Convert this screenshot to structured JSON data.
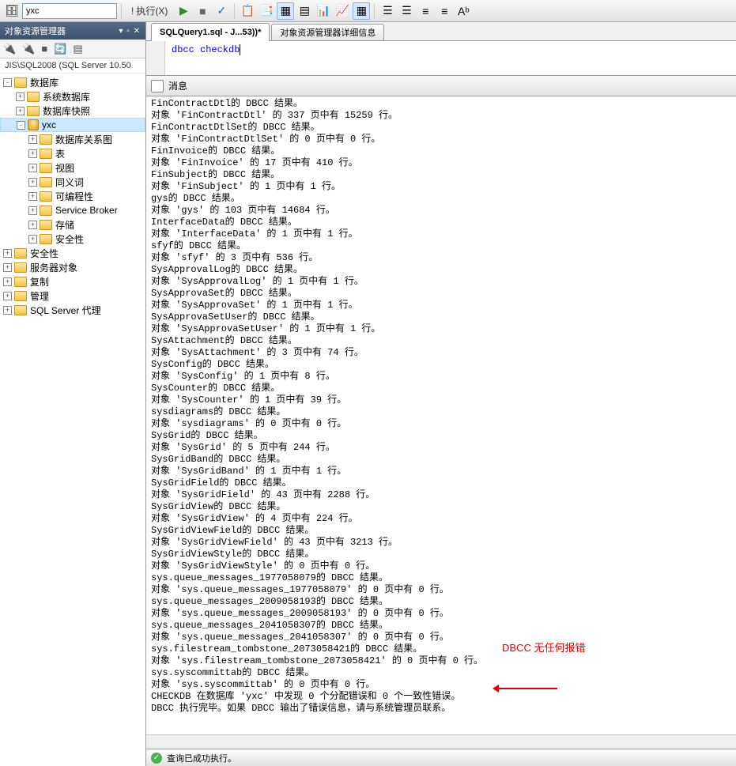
{
  "toolbar": {
    "combo_value": "yxc",
    "exec_label": "执行(X)",
    "icons": [
      "play-icon",
      "debug-icon",
      "check-icon",
      "new-icon",
      "save-icon",
      "grid-icon",
      "grid2-icon",
      "table-icon",
      "cols-icon",
      "props-icon",
      "sep",
      "indent-icon",
      "outdent-icon",
      "left-icon",
      "right-icon",
      "font-icon"
    ]
  },
  "sidebar": {
    "title": "对象资源管理器",
    "pin_label": "▾ ▫ ✕",
    "server": "JIS\\SQL2008 (SQL Server 10.50",
    "tools": [
      "🔗",
      "🔗",
      "▦",
      "🔄",
      "▤"
    ],
    "items": [
      {
        "level": 0,
        "exp": "-",
        "type": "folder",
        "label": "数据库",
        "sel": false
      },
      {
        "level": 1,
        "exp": "+",
        "type": "folder",
        "label": "系统数据库",
        "sel": false
      },
      {
        "level": 1,
        "exp": "+",
        "type": "folder",
        "label": "数据库快照",
        "sel": false
      },
      {
        "level": 1,
        "exp": "-",
        "type": "db",
        "label": "yxc",
        "sel": true
      },
      {
        "level": 2,
        "exp": "+",
        "type": "folder",
        "label": "数据库关系图",
        "sel": false
      },
      {
        "level": 2,
        "exp": "+",
        "type": "folder",
        "label": "表",
        "sel": false
      },
      {
        "level": 2,
        "exp": "+",
        "type": "folder",
        "label": "视图",
        "sel": false
      },
      {
        "level": 2,
        "exp": "+",
        "type": "folder",
        "label": "同义词",
        "sel": false
      },
      {
        "level": 2,
        "exp": "+",
        "type": "folder",
        "label": "可编程性",
        "sel": false
      },
      {
        "level": 2,
        "exp": "+",
        "type": "folder",
        "label": "Service Broker",
        "sel": false
      },
      {
        "level": 2,
        "exp": "+",
        "type": "folder",
        "label": "存储",
        "sel": false
      },
      {
        "level": 2,
        "exp": "+",
        "type": "folder",
        "label": "安全性",
        "sel": false
      },
      {
        "level": 0,
        "exp": "+",
        "type": "folder",
        "label": "安全性",
        "sel": false
      },
      {
        "level": 0,
        "exp": "+",
        "type": "folder",
        "label": "服务器对象",
        "sel": false
      },
      {
        "level": 0,
        "exp": "+",
        "type": "folder",
        "label": "复制",
        "sel": false
      },
      {
        "level": 0,
        "exp": "+",
        "type": "folder",
        "label": "管理",
        "sel": false
      },
      {
        "level": 0,
        "exp": "+",
        "type": "folder",
        "label": "SQL Server 代理",
        "sel": false
      }
    ]
  },
  "tabs": {
    "active": "SQLQuery1.sql - J...53))*",
    "other": "对象资源管理器详细信息"
  },
  "editor": {
    "code_keyword": "dbcc checkdb"
  },
  "messages_tab": "消息",
  "results": [
    "FinContractDtl的 DBCC 结果。",
    "对象 'FinContractDtl' 的 337 页中有 15259 行。",
    "FinContractDtlSet的 DBCC 结果。",
    "对象 'FinContractDtlSet' 的 0 页中有 0 行。",
    "FinInvoice的 DBCC 结果。",
    "对象 'FinInvoice' 的 17 页中有 410 行。",
    "FinSubject的 DBCC 结果。",
    "对象 'FinSubject' 的 1 页中有 1 行。",
    "gys的 DBCC 结果。",
    "对象 'gys' 的 103 页中有 14684 行。",
    "InterfaceData的 DBCC 结果。",
    "对象 'InterfaceData' 的 1 页中有 1 行。",
    "sfyf的 DBCC 结果。",
    "对象 'sfyf' 的 3 页中有 536 行。",
    "SysApprovalLog的 DBCC 结果。",
    "对象 'SysApprovalLog' 的 1 页中有 1 行。",
    "SysApprovaSet的 DBCC 结果。",
    "对象 'SysApprovaSet' 的 1 页中有 1 行。",
    "SysApprovaSetUser的 DBCC 结果。",
    "对象 'SysApprovaSetUser' 的 1 页中有 1 行。",
    "SysAttachment的 DBCC 结果。",
    "对象 'SysAttachment' 的 3 页中有 74 行。",
    "SysConfig的 DBCC 结果。",
    "对象 'SysConfig' 的 1 页中有 8 行。",
    "SysCounter的 DBCC 结果。",
    "对象 'SysCounter' 的 1 页中有 39 行。",
    "sysdiagrams的 DBCC 结果。",
    "对象 'sysdiagrams' 的 0 页中有 0 行。",
    "SysGrid的 DBCC 结果。",
    "对象 'SysGrid' 的 5 页中有 244 行。",
    "SysGridBand的 DBCC 结果。",
    "对象 'SysGridBand' 的 1 页中有 1 行。",
    "SysGridField的 DBCC 结果。",
    "对象 'SysGridField' 的 43 页中有 2288 行。",
    "SysGridView的 DBCC 结果。",
    "对象 'SysGridView' 的 4 页中有 224 行。",
    "SysGridViewField的 DBCC 结果。",
    "对象 'SysGridViewField' 的 43 页中有 3213 行。",
    "SysGridViewStyle的 DBCC 结果。",
    "对象 'SysGridViewStyle' 的 0 页中有 0 行。",
    "sys.queue_messages_1977058079的 DBCC 结果。",
    "对象 'sys.queue_messages_1977058079' 的 0 页中有 0 行。",
    "sys.queue_messages_2009058193的 DBCC 结果。",
    "对象 'sys.queue_messages_2009058193' 的 0 页中有 0 行。",
    "sys.queue_messages_2041058307的 DBCC 结果。",
    "对象 'sys.queue_messages_2041058307' 的 0 页中有 0 行。",
    "sys.filestream_tombstone_2073058421的 DBCC 结果。",
    "对象 'sys.filestream_tombstone_2073058421' 的 0 页中有 0 行。",
    "sys.syscommittab的 DBCC 结果。",
    "对象 'sys.syscommittab' 的 0 页中有 0 行。",
    "CHECKDB 在数据库 'yxc' 中发现 0 个分配错误和 0 个一致性错误。",
    "DBCC 执行完毕。如果 DBCC 输出了错误信息，请与系统管理员联系。"
  ],
  "annotation": "DBCC 无任何报错",
  "status": {
    "text": "查询已成功执行。",
    "ok": "✓"
  }
}
